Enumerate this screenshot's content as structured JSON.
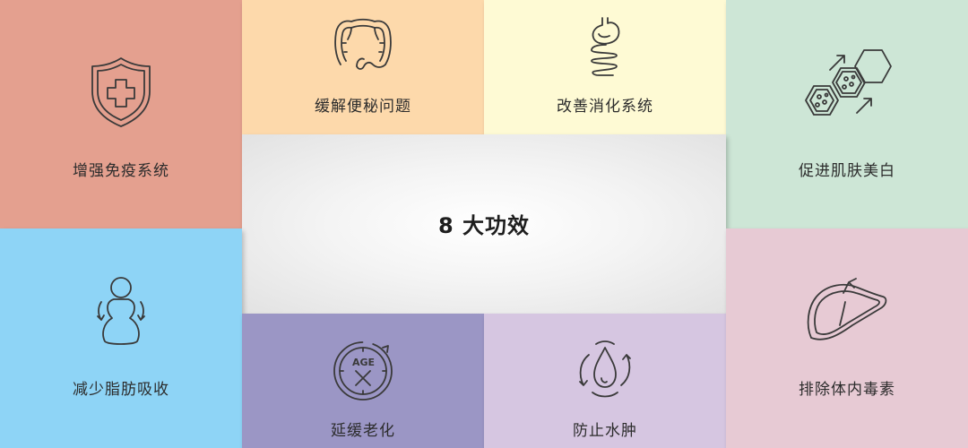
{
  "center": {
    "title": "8 大功效"
  },
  "tiles": {
    "immunity": {
      "label": "增强免疫系统",
      "icon": "shield-cross-icon",
      "color": "#e4a08f"
    },
    "constipation": {
      "label": "缓解便秘问题",
      "icon": "intestine-icon",
      "color": "#fdd9ab"
    },
    "digestion": {
      "label": "改善消化系统",
      "icon": "stomach-icon",
      "color": "#fefad4"
    },
    "skin": {
      "label": "促进肌肤美白",
      "icon": "skin-cells-icon",
      "color": "#cde6d6"
    },
    "fat": {
      "label": "减少脂肪吸收",
      "icon": "body-shape-icon",
      "color": "#8ed4f6"
    },
    "aging": {
      "label": "延缓老化",
      "icon": "anti-age-icon",
      "color": "#9b96c5",
      "icon_text": "AGE"
    },
    "edema": {
      "label": "防止水肿",
      "icon": "water-drop-cycle-icon",
      "color": "#d6c6e1"
    },
    "detox": {
      "label": "排除体内毒素",
      "icon": "liver-icon",
      "color": "#e7cad4"
    }
  }
}
